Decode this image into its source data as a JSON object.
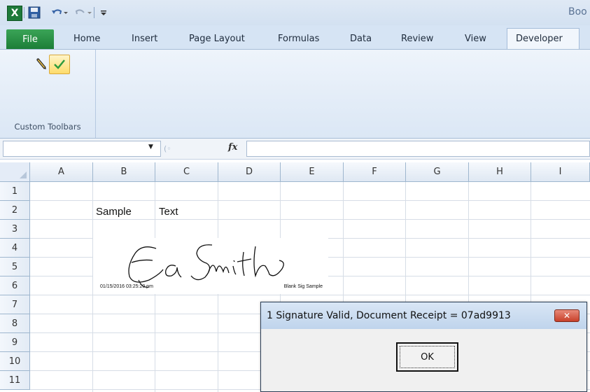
{
  "window": {
    "title": "Boo"
  },
  "ribbon": {
    "file_tab": "File",
    "tabs": [
      "Home",
      "Insert",
      "Page Layout",
      "Formulas",
      "Data",
      "Review",
      "View",
      "Developer"
    ],
    "group_label": "Custom Toolbars"
  },
  "formula_bar": {
    "name_box": "",
    "fx_label": "fx",
    "formula": ""
  },
  "grid": {
    "columns": [
      "A",
      "B",
      "C",
      "D",
      "E",
      "F",
      "G",
      "H",
      "I"
    ],
    "rows": [
      "1",
      "2",
      "3",
      "4",
      "5",
      "6",
      "7",
      "8",
      "9",
      "10",
      "11"
    ],
    "cells": {
      "B2": "Sample",
      "C2": "Text"
    }
  },
  "signature": {
    "date_text": "01/15/2016 03:25:20 pm",
    "caption": "Blank Sig Sample"
  },
  "dialog": {
    "title": "1 Signature Valid, Document Receipt = 07ad9913",
    "ok_label": "OK"
  },
  "colors": {
    "file_tab": "#1c7e37",
    "ribbon": "#dbe7f5",
    "dialog_close": "#c8402a"
  }
}
